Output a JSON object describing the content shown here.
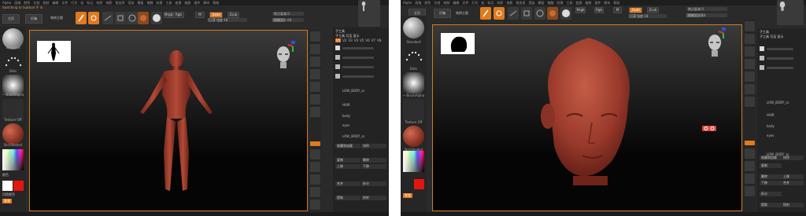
{
  "colors": {
    "accent": "#e07a1f",
    "skin": "#9a3a2c",
    "swatch_red": "#e3160e",
    "swatch_white": "#ffffff"
  },
  "left": {
    "menu": [
      "Alpha",
      "画笔",
      "颜色",
      "文档",
      "绘制",
      "编辑",
      "文件",
      "灯光",
      "宏",
      "标记",
      "材质",
      "电影",
      "首选项",
      "渲染",
      "模板",
      "笔触",
      "纹理",
      "工具",
      "变换",
      "缩放",
      "插件",
      "脚本",
      "帮助"
    ],
    "status": "Switching to Subtool 手 头",
    "toolbar": {
      "btn1": "主页",
      "btn2": "灯箱",
      "btn3": "笔刷主题",
      "mrgb": "Mrgb",
      "rgb": "Rgb",
      "m": "M",
      "zadd": "Zadd",
      "zsub": "Zsub",
      "zint_label": "Z 强度",
      "zint_val": "18",
      "focal_label": "焦点衰减 0",
      "draw_label": "绘制大小 64"
    },
    "brush_labels": [
      "Standard",
      "Dots",
      "~ BrushAlpha",
      "Texture Off",
      "SkinShade4"
    ],
    "color_label": "颜色",
    "toggle_label": "切换颜色",
    "gradient_label": "渐变",
    "rightpanel": {
      "title": "子工具",
      "subtitle": "子工具 可见 显示",
      "tabs": [
        "V1",
        "V2",
        "V3",
        "V4",
        "V5",
        "V6",
        "V7",
        "V8"
      ],
      "items": [
        "LOW_BODY_sc",
        "HAIR",
        "body",
        "eyes",
        "LOW_BODY_sc"
      ],
      "menu": [
        "收藏和加载",
        "排序",
        "复制",
        "删除",
        "上移",
        "下移",
        "合并",
        "拆分",
        "提取",
        "投射"
      ]
    }
  },
  "right": {
    "menu": [
      "Alpha",
      "画笔",
      "颜色",
      "文档",
      "绘制",
      "编辑",
      "文件",
      "灯光",
      "宏",
      "标记",
      "材质",
      "电影",
      "首选项",
      "渲染",
      "模板",
      "笔触",
      "纹理",
      "工具",
      "变换",
      "缩放",
      "插件",
      "脚本",
      "帮助"
    ],
    "toolbar": {
      "btn1": "主页",
      "btn2": "灯箱",
      "btn3": "笔刷主题",
      "mrgb": "Mrgb",
      "rgb": "Rgb",
      "m": "M",
      "zadd": "Zadd",
      "zsub": "Zsub",
      "zint_label": "Z 强度",
      "zint_val": "18",
      "focal_label": "焦点衰减 0",
      "draw_label": "绘制大小 64"
    },
    "brush_labels": [
      "Standard",
      "Dots",
      "~ BrushAlpha",
      "Texture Off",
      "SkinShade4"
    ],
    "rightpanel": {
      "title": "子工具",
      "subtitle": "子工具 可见 显示",
      "items": [
        "LOW_BODY_sc",
        "HAIR",
        "body",
        "eyes",
        "LOW_BODY_sc"
      ],
      "menu": [
        "收藏和加载",
        "排序",
        "复制",
        "删除",
        "上移",
        "下移",
        "合并",
        "拆分",
        "提取",
        "投射"
      ]
    }
  }
}
